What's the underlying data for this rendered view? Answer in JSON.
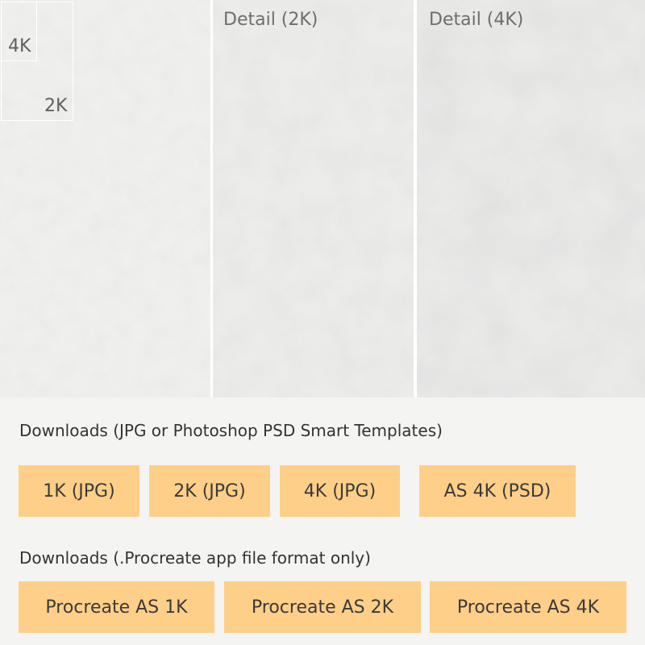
{
  "previews": {
    "panel_2k_title": "Detail (2K)",
    "panel_4k_title": "Detail (4K)",
    "size_label_4k": "4K",
    "size_label_2k": "2K"
  },
  "downloads": {
    "jpg_psd": {
      "title": "Downloads (JPG or Photoshop PSD Smart Templates)",
      "buttons": [
        "1K (JPG)",
        "2K (JPG)",
        "4K (JPG)",
        "AS 4K (PSD)"
      ]
    },
    "procreate": {
      "title": "Downloads (.Procreate app file format only)",
      "buttons": [
        "Procreate AS 1K",
        "Procreate AS 2K",
        "Procreate AS 4K"
      ]
    }
  },
  "colors": {
    "button_bg": "#fecf88",
    "page_bg": "#f4f4f3",
    "texture_base": "#ededec"
  }
}
